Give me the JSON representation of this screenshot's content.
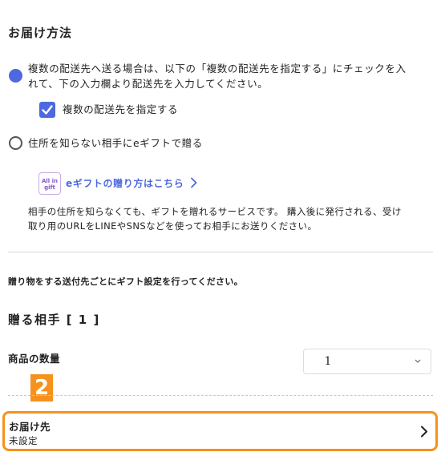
{
  "delivery": {
    "title": "お届け方法",
    "option_multiple": {
      "line1": "複数の配送先へ送る場合は、以下の「複数の配送先を指定する」にチェックを入",
      "line2": "れて、下の入力欄より配送先を入力してください。",
      "checkbox_label": "複数の配送先を指定する",
      "checked": true
    },
    "option_egift": {
      "label": "住所を知らない相手にeギフトで贈る",
      "selected": false
    },
    "egift_link": {
      "badge_line1": "All in",
      "badge_line2": "gift",
      "label": "eギフトの贈り方はこちら"
    },
    "egift_desc": {
      "line1": "相手の住所を知らなくても、ギフトを贈れるサービスです。 購入後に発行される、受け",
      "line2": "取り用のURLをLINEやSNSなどを使ってお相手にお送りください。"
    }
  },
  "gift_instruction": "贈り物をする送付先ごとにギフト設定を行ってください。",
  "recipient": {
    "heading": "贈る相手 [ 1 ]",
    "quantity_label": "商品の数量",
    "quantity_value": "1"
  },
  "step_badge": "2",
  "destination": {
    "title": "お届け先",
    "status": "未設定"
  },
  "colors": {
    "accent": "#4d68e0",
    "highlight": "#f5921e"
  }
}
